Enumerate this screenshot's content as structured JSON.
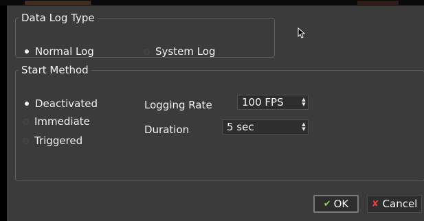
{
  "data_log_type": {
    "title": "Data Log Type",
    "options": [
      {
        "label": "Normal Log",
        "selected": true
      },
      {
        "label": "System Log",
        "selected": false
      }
    ]
  },
  "start_method": {
    "title": "Start Method",
    "options": [
      {
        "label": "Deactivated",
        "selected": true
      },
      {
        "label": "Immediate",
        "selected": false
      },
      {
        "label": "Triggered",
        "selected": false
      }
    ],
    "logging_rate": {
      "label": "Logging Rate",
      "value": "100 FPS"
    },
    "duration": {
      "label": "Duration",
      "value": "5 sec"
    }
  },
  "buttons": {
    "ok": "OK",
    "cancel": "Cancel"
  },
  "icons": {
    "ok": "check-icon",
    "cancel": "x-icon",
    "cursor": "mouse-pointer-icon"
  },
  "colors": {
    "dialog_bg": "#3b3b3b",
    "ok_check": "#8fd14f",
    "cancel_x": "#e04040"
  }
}
